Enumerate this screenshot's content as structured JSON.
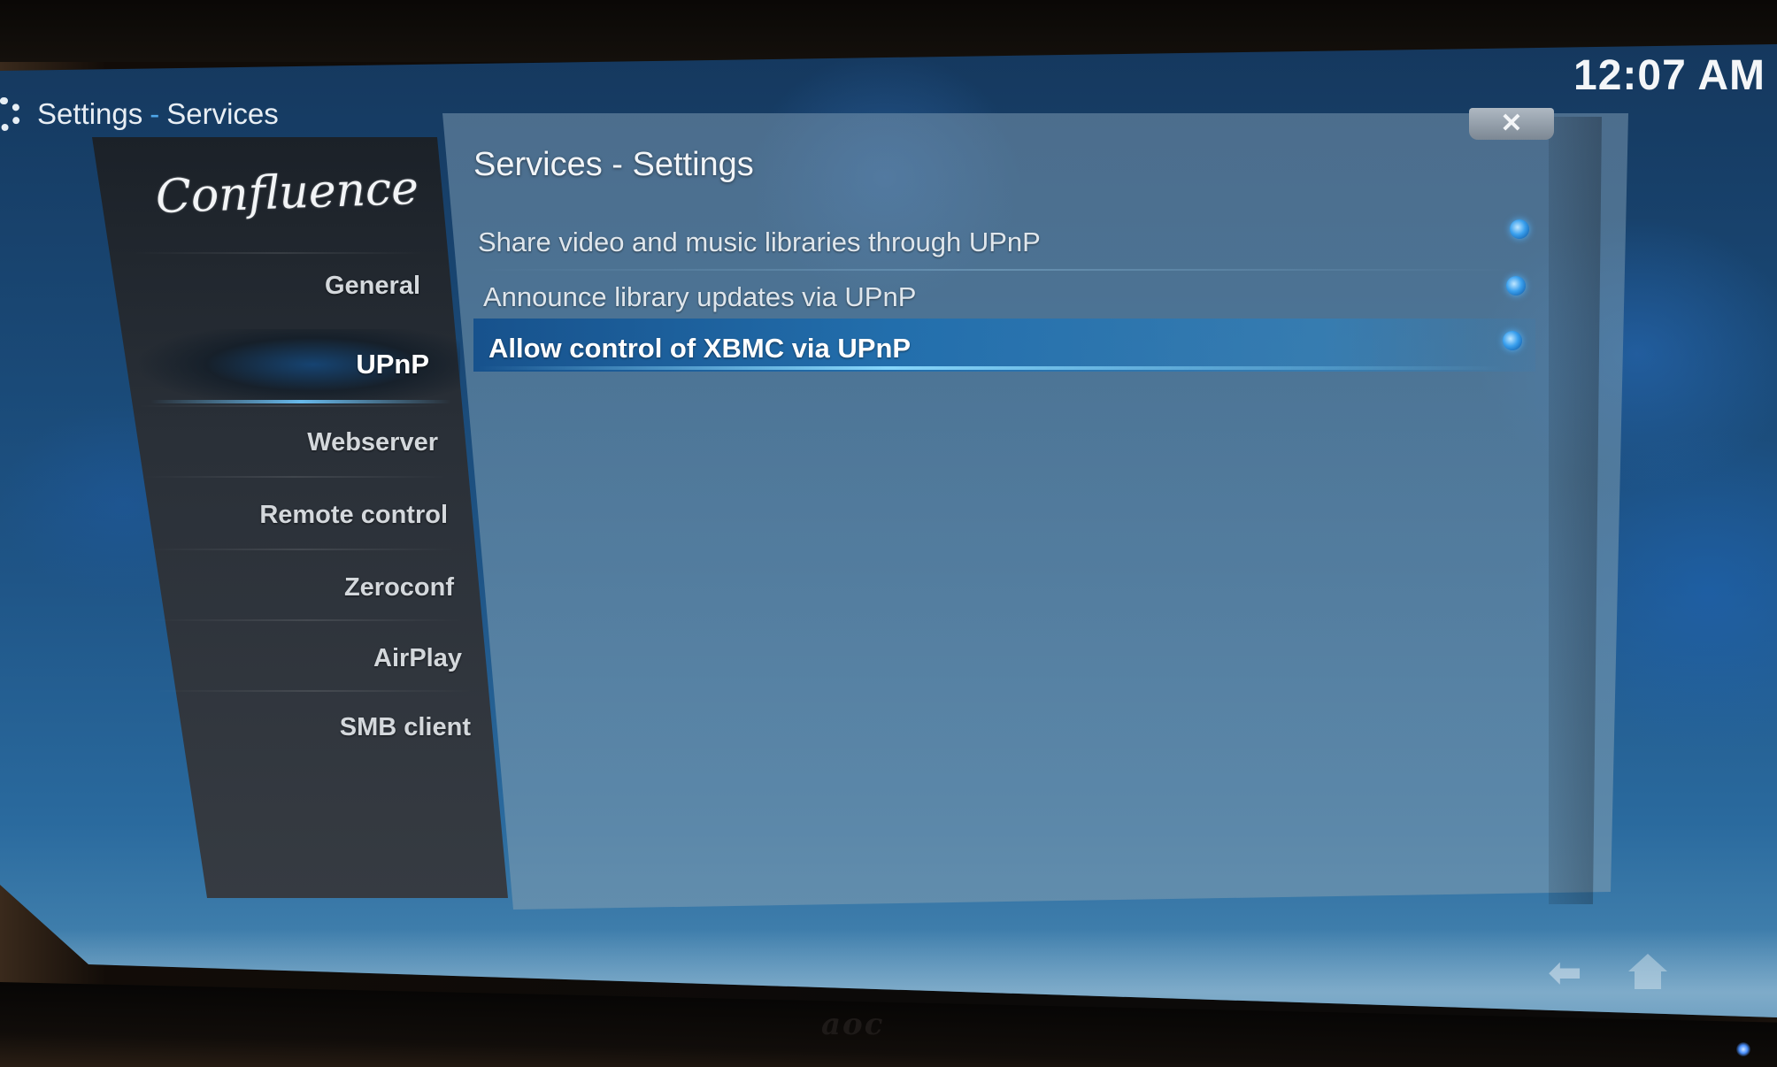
{
  "header": {
    "breadcrumb_root": "Settings",
    "breadcrumb_separator": "-",
    "breadcrumb_current": "Services",
    "clock": "12:07 AM"
  },
  "skin_logo": "Confluence",
  "nav": {
    "items": [
      {
        "label": "General",
        "active": false
      },
      {
        "label": "UPnP",
        "active": true
      },
      {
        "label": "Webserver",
        "active": false
      },
      {
        "label": "Remote control",
        "active": false
      },
      {
        "label": "Zeroconf",
        "active": false
      },
      {
        "label": "AirPlay",
        "active": false
      },
      {
        "label": "SMB client",
        "active": false
      }
    ]
  },
  "content": {
    "title": "Services - Settings",
    "close_icon": "close-icon",
    "settings": [
      {
        "label": "Share video and music libraries through UPnP",
        "enabled": true,
        "focused": false
      },
      {
        "label": "Announce library updates via UPnP",
        "enabled": true,
        "focused": false
      },
      {
        "label": "Allow control of XBMC via UPnP",
        "enabled": true,
        "focused": true
      }
    ]
  },
  "footer_icons": [
    "back-icon",
    "home-icon"
  ],
  "monitor_brand": "aoc",
  "colors": {
    "accent": "#3aa0ee",
    "background_top": "#15385e",
    "background_bottom": "#4f8db6",
    "nav_panel": "#2a3038"
  }
}
